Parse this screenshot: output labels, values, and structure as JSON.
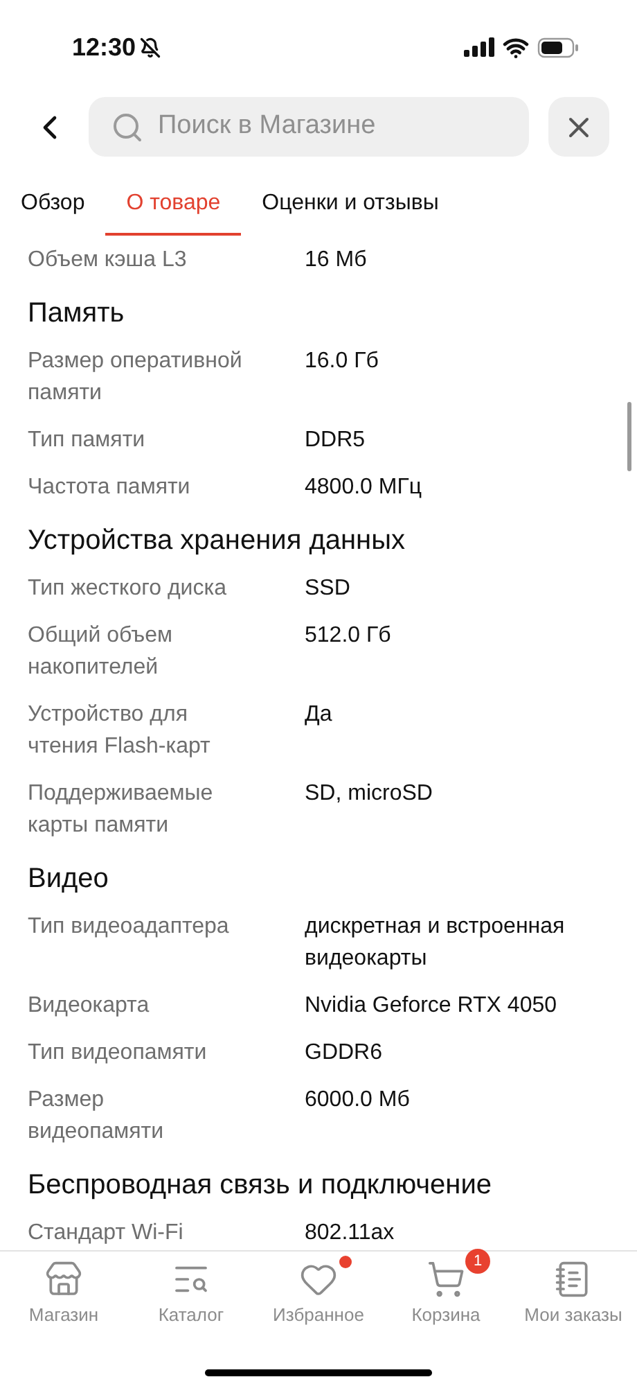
{
  "status_bar": {
    "time": "12:30",
    "silenced": true
  },
  "search": {
    "placeholder": "Поиск в Магазине"
  },
  "tabs": [
    {
      "label": "Обзор",
      "selected": false
    },
    {
      "label": "О товаре",
      "selected": true
    },
    {
      "label": "Оценки и отзывы",
      "selected": false
    }
  ],
  "sections": [
    {
      "rows": [
        {
          "label": "Объем кэша L3",
          "value": "16 Мб"
        }
      ]
    },
    {
      "title": "Память",
      "rows": [
        {
          "label": "Размер оперативной памяти",
          "value": "16.0 Гб"
        },
        {
          "label": "Тип памяти",
          "value": "DDR5"
        },
        {
          "label": "Частота памяти",
          "value": "4800.0 МГц"
        }
      ]
    },
    {
      "title": "Устройства хранения данных",
      "rows": [
        {
          "label": "Тип жесткого диска",
          "value": "SSD"
        },
        {
          "label": "Общий объем накопителей",
          "value": "512.0 Гб"
        },
        {
          "label": "Устройство для чтения Flash-карт",
          "value": "Да"
        },
        {
          "label": "Поддерживаемые карты памяти",
          "value": "SD, microSD"
        }
      ]
    },
    {
      "title": "Видео",
      "rows": [
        {
          "label": "Тип видеоадаптера",
          "value": "дискретная и встроенная видеокарты"
        },
        {
          "label": "Видеокарта",
          "value": "Nvidia Geforce RTX 4050"
        },
        {
          "label": "Тип видеопамяти",
          "value": "GDDR6"
        },
        {
          "label": "Размер видеопамяти",
          "value": "6000.0 Мб"
        }
      ]
    },
    {
      "title": "Беспроводная связь и подключение",
      "rows": [
        {
          "label": "Стандарт Wi-Fi",
          "value": "802.11ax"
        }
      ]
    }
  ],
  "bottom_nav": [
    {
      "kind": "store",
      "label": "Магазин",
      "selected": false,
      "dot": false
    },
    {
      "kind": "catalog",
      "label": "Каталог",
      "selected": false,
      "dot": false
    },
    {
      "kind": "favorites",
      "label": "Избранное",
      "selected": false,
      "dot": true
    },
    {
      "kind": "cart",
      "label": "Корзина",
      "selected": false,
      "dot": false,
      "badge": "1"
    },
    {
      "kind": "orders",
      "label": "Мои заказы",
      "selected": false,
      "dot": false
    }
  ]
}
